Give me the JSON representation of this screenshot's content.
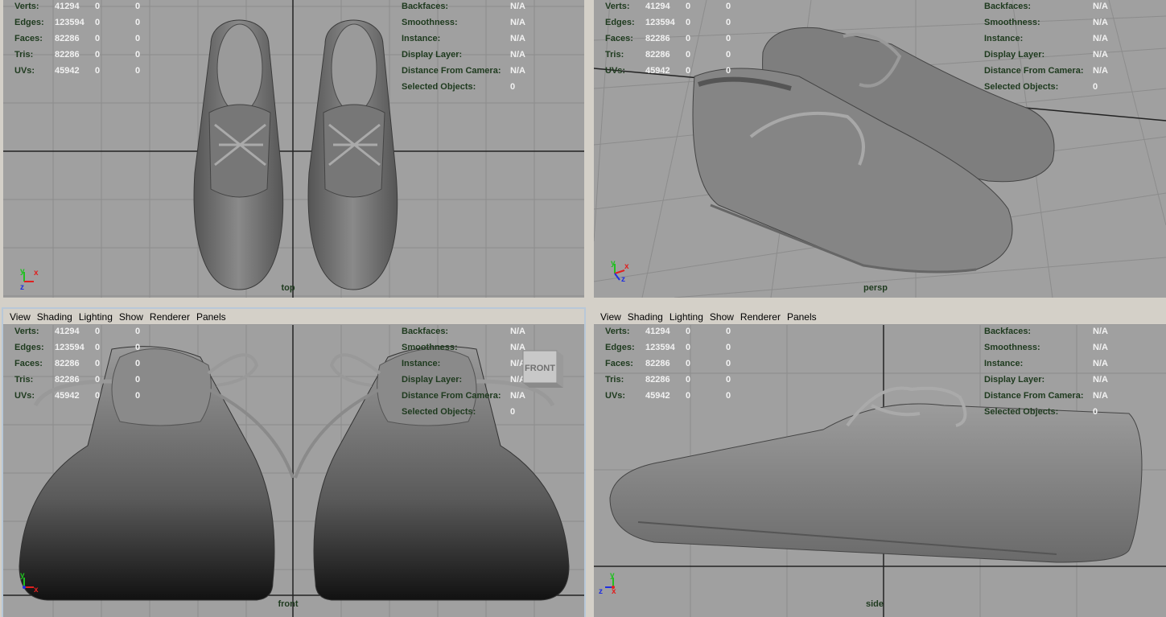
{
  "stats": {
    "left": [
      {
        "label": "Verts:",
        "v1": "41294",
        "v2": "0",
        "v3": "0"
      },
      {
        "label": "Edges:",
        "v1": "123594",
        "v2": "0",
        "v3": "0"
      },
      {
        "label": "Faces:",
        "v1": "82286",
        "v2": "0",
        "v3": "0"
      },
      {
        "label": "Tris:",
        "v1": "82286",
        "v2": "0",
        "v3": "0"
      },
      {
        "label": "UVs:",
        "v1": "45942",
        "v2": "0",
        "v3": "0"
      }
    ],
    "right": [
      {
        "label": "Backfaces:",
        "value": "N/A"
      },
      {
        "label": "Smoothness:",
        "value": "N/A"
      },
      {
        "label": "Instance:",
        "value": "N/A"
      },
      {
        "label": "Display Layer:",
        "value": "N/A"
      },
      {
        "label": "Distance From Camera:",
        "value": "N/A"
      },
      {
        "label": "Selected Objects:",
        "value": "0"
      }
    ]
  },
  "menu": [
    "View",
    "Shading",
    "Lighting",
    "Show",
    "Renderer",
    "Panels"
  ],
  "viewports": {
    "top": {
      "camera": "top",
      "axes": [
        "y",
        "x",
        "z"
      ]
    },
    "persp": {
      "camera": "persp",
      "axes": [
        "y",
        "x",
        "z"
      ]
    },
    "front": {
      "camera": "front",
      "axes": [
        "y",
        "x"
      ],
      "cube_label": "FRONT"
    },
    "side": {
      "camera": "side",
      "axes": [
        "y",
        "z",
        "x"
      ]
    }
  },
  "colors": {
    "viewport_bg": "#a0a0a0",
    "label_green": "#1e3a1e",
    "value_white": "#f2f2f2",
    "axis_x": "#e02020",
    "axis_y": "#20c020",
    "axis_z": "#2030e0"
  }
}
